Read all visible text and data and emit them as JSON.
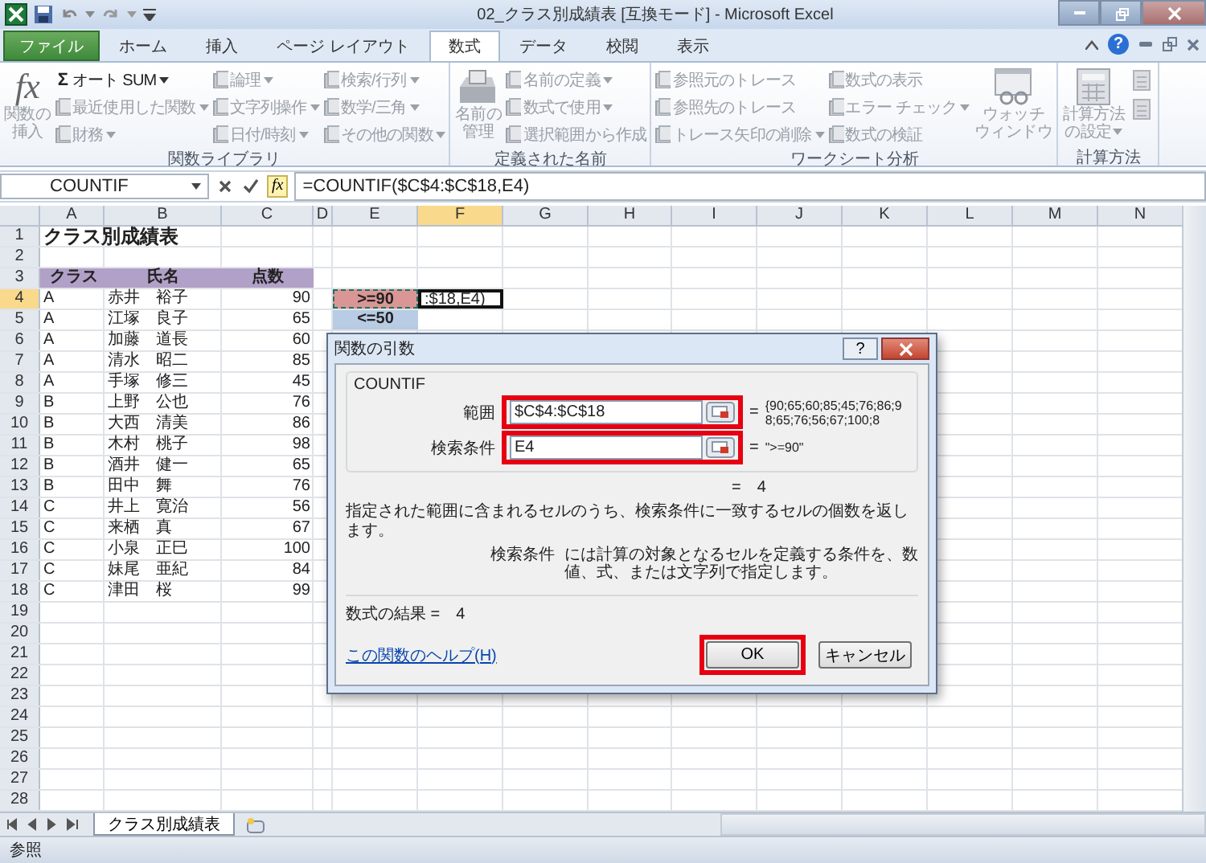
{
  "window": {
    "title": "02_クラス別成績表  [互換モード]  -  Microsoft Excel"
  },
  "file_tab": "ファイル",
  "tabs": [
    {
      "label": "ホーム",
      "selected": false
    },
    {
      "label": "挿入",
      "selected": false
    },
    {
      "label": "ページ レイアウト",
      "selected": false
    },
    {
      "label": "数式",
      "selected": true
    },
    {
      "label": "データ",
      "selected": false
    },
    {
      "label": "校閲",
      "selected": false
    },
    {
      "label": "表示",
      "selected": false
    }
  ],
  "help": "?",
  "ribbon": {
    "groups": [
      {
        "label": "関数ライブラリ",
        "columns": [
          [
            {
              "kind": "large",
              "label": "関数の挿入",
              "glyph": "fx",
              "disabled": true,
              "dropdown": false
            }
          ],
          [
            {
              "kind": "small",
              "label": "オート SUM",
              "glyph": "Σ",
              "disabled": false,
              "dropdown": true
            },
            {
              "kind": "small",
              "label": "最近使用した関数",
              "disabled": true,
              "dropdown": true
            },
            {
              "kind": "small",
              "label": "財務",
              "disabled": true,
              "dropdown": true
            }
          ],
          [
            {
              "kind": "small",
              "label": "論理",
              "disabled": true,
              "dropdown": true
            },
            {
              "kind": "small",
              "label": "文字列操作",
              "disabled": true,
              "dropdown": true
            },
            {
              "kind": "small",
              "label": "日付/時刻",
              "disabled": true,
              "dropdown": true
            }
          ],
          [
            {
              "kind": "small",
              "label": "検索/行列",
              "disabled": true,
              "dropdown": true
            },
            {
              "kind": "small",
              "label": "数学/三角",
              "disabled": true,
              "dropdown": true
            },
            {
              "kind": "small",
              "label": "その他の関数",
              "disabled": true,
              "dropdown": true
            }
          ]
        ]
      },
      {
        "label": "定義された名前",
        "columns": [
          [
            {
              "kind": "large",
              "label": "名前の管理",
              "disabled": true,
              "dropdown": false
            }
          ],
          [
            {
              "kind": "small",
              "label": "名前の定義",
              "disabled": true,
              "dropdown": true
            },
            {
              "kind": "small",
              "label": "数式で使用",
              "disabled": true,
              "dropdown": true
            },
            {
              "kind": "small",
              "label": "選択範囲から作成",
              "disabled": true,
              "dropdown": false
            }
          ]
        ]
      },
      {
        "label": "ワークシート分析",
        "columns": [
          [
            {
              "kind": "small",
              "label": "参照元のトレース",
              "disabled": true,
              "dropdown": false
            },
            {
              "kind": "small",
              "label": "参照先のトレース",
              "disabled": true,
              "dropdown": false
            },
            {
              "kind": "small",
              "label": "トレース矢印の削除",
              "disabled": true,
              "dropdown": true
            }
          ],
          [
            {
              "kind": "small",
              "label": "数式の表示",
              "disabled": true,
              "dropdown": false
            },
            {
              "kind": "small",
              "label": "エラー チェック",
              "disabled": true,
              "dropdown": true
            },
            {
              "kind": "small",
              "label": "数式の検証",
              "disabled": true,
              "dropdown": false
            }
          ],
          [
            {
              "kind": "large",
              "label": "ウォッチウィンドウ",
              "disabled": true,
              "dropdown": false
            }
          ]
        ]
      },
      {
        "label": "計算方法",
        "columns": [
          [
            {
              "kind": "large",
              "label": "計算方法の設定",
              "disabled": true,
              "dropdown": true
            }
          ],
          [
            {
              "kind": "icon",
              "disabled": true,
              "dropdown": false
            },
            {
              "kind": "icon",
              "disabled": true,
              "dropdown": false
            }
          ]
        ]
      }
    ]
  },
  "formula_bar": {
    "name_box": "COUNTIF",
    "fx": "fx",
    "formula": "=COUNTIF($C$4:$C$18,E4)"
  },
  "sheet": {
    "columns": [
      {
        "label": "A",
        "selected": false
      },
      {
        "label": "B",
        "selected": false
      },
      {
        "label": "C",
        "selected": false
      },
      {
        "label": "D",
        "selected": false
      },
      {
        "label": "E",
        "selected": false
      },
      {
        "label": "F",
        "selected": true
      },
      {
        "label": "G",
        "selected": false
      },
      {
        "label": "H",
        "selected": false
      },
      {
        "label": "I",
        "selected": false
      },
      {
        "label": "J",
        "selected": false
      },
      {
        "label": "K",
        "selected": false
      },
      {
        "label": "L",
        "selected": false
      },
      {
        "label": "M",
        "selected": false
      },
      {
        "label": "N",
        "selected": false
      }
    ],
    "rows": [
      {
        "number": "1",
        "selected": false,
        "kind": "title",
        "title": "クラス別成績表"
      },
      {
        "number": "2",
        "selected": false,
        "kind": "blank"
      },
      {
        "number": "3",
        "selected": false,
        "kind": "header",
        "class": "クラス",
        "name": "氏名",
        "score": "点数"
      },
      {
        "number": "4",
        "selected": true,
        "kind": "data",
        "class": "A",
        "name": "赤井　裕子",
        "score": "90",
        "criteria": {
          "text": ">=90",
          "color": "#da9694",
          "copying": true
        },
        "editing": ":$18,E4)"
      },
      {
        "number": "5",
        "selected": false,
        "kind": "data",
        "class": "A",
        "name": "江塚　良子",
        "score": "65",
        "criteria": {
          "text": "<=50",
          "color": "#b8cce4",
          "copying": false
        }
      },
      {
        "number": "6",
        "selected": false,
        "kind": "data",
        "class": "A",
        "name": "加藤　道長",
        "score": "60"
      },
      {
        "number": "7",
        "selected": false,
        "kind": "data",
        "class": "A",
        "name": "清水　昭二",
        "score": "85"
      },
      {
        "number": "8",
        "selected": false,
        "kind": "data",
        "class": "A",
        "name": "手塚　修三",
        "score": "45"
      },
      {
        "number": "9",
        "selected": false,
        "kind": "data",
        "class": "B",
        "name": "上野　公也",
        "score": "76"
      },
      {
        "number": "10",
        "selected": false,
        "kind": "data",
        "class": "B",
        "name": "大西　清美",
        "score": "86"
      },
      {
        "number": "11",
        "selected": false,
        "kind": "data",
        "class": "B",
        "name": "木村　桃子",
        "score": "98"
      },
      {
        "number": "12",
        "selected": false,
        "kind": "data",
        "class": "B",
        "name": "酒井　健一",
        "score": "65"
      },
      {
        "number": "13",
        "selected": false,
        "kind": "data",
        "class": "B",
        "name": "田中　舞",
        "score": "76"
      },
      {
        "number": "14",
        "selected": false,
        "kind": "data",
        "class": "C",
        "name": "井上　寛治",
        "score": "56"
      },
      {
        "number": "15",
        "selected": false,
        "kind": "data",
        "class": "C",
        "name": "来栖　真",
        "score": "67"
      },
      {
        "number": "16",
        "selected": false,
        "kind": "data",
        "class": "C",
        "name": "小泉　正巳",
        "score": "100"
      },
      {
        "number": "17",
        "selected": false,
        "kind": "data",
        "class": "C",
        "name": "妹尾　亜紀",
        "score": "84"
      },
      {
        "number": "18",
        "selected": false,
        "kind": "data",
        "class": "C",
        "name": "津田　桜",
        "score": "99"
      },
      {
        "number": "19",
        "selected": false,
        "kind": "blank"
      },
      {
        "number": "20",
        "selected": false,
        "kind": "blank"
      },
      {
        "number": "21",
        "selected": false,
        "kind": "blank"
      },
      {
        "number": "22",
        "selected": false,
        "kind": "blank"
      },
      {
        "number": "23",
        "selected": false,
        "kind": "blank"
      },
      {
        "number": "24",
        "selected": false,
        "kind": "blank"
      },
      {
        "number": "25",
        "selected": false,
        "kind": "blank"
      },
      {
        "number": "26",
        "selected": false,
        "kind": "blank"
      },
      {
        "number": "27",
        "selected": false,
        "kind": "blank"
      },
      {
        "number": "28",
        "selected": false,
        "kind": "blank"
      }
    ],
    "sheet_tabs": [
      {
        "label": "クラス別成績表",
        "selected": true
      }
    ]
  },
  "dialog": {
    "title": "関数の引数",
    "help": "?",
    "function": "COUNTIF",
    "arguments": [
      {
        "label": "範囲",
        "value": "$C$4:$C$18",
        "sign": "=",
        "result": "{90;65;60;85;45;76;86;98;65;76;56;67;100;8",
        "highlighted": true
      },
      {
        "label": "検索条件",
        "value": "E4",
        "sign": "=",
        "result": "\">=90\"",
        "highlighted": true
      }
    ],
    "function_result": "=　4",
    "description": "指定された範囲に含まれるセルのうち、検索条件に一致するセルの個数を返します。",
    "argument_help": {
      "label": "検索条件",
      "text": "には計算の対象となるセルを定義する条件を、数値、式、または文字列で指定します。"
    },
    "formula_result": "数式の結果 =　4",
    "help_link": "この関数のヘルプ(H)",
    "buttons": [
      {
        "label": "OK",
        "highlighted": true
      },
      {
        "label": "キャンセル",
        "highlighted": false
      }
    ]
  },
  "status_bar": {
    "mode": "参照"
  }
}
